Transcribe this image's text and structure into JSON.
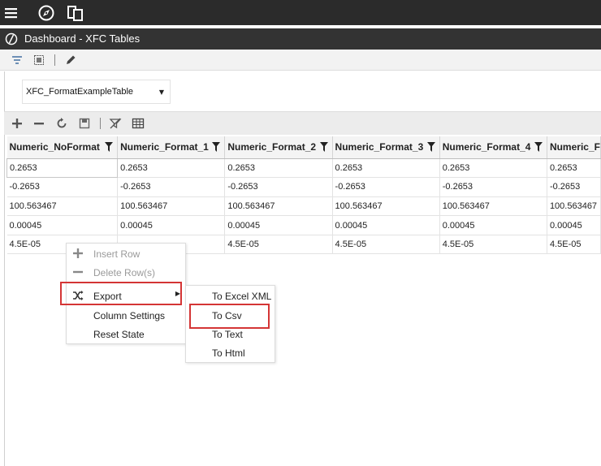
{
  "appbar": {
    "icons": [
      "hamburger-menu-icon",
      "navigation-compass-icon",
      "pages-icon"
    ]
  },
  "titlebar": {
    "title": "Dashboard - XFC Tables"
  },
  "small_toolbar": {
    "icons": [
      "filter-icon",
      "select-icon",
      "edit-pencil-icon"
    ]
  },
  "combo": {
    "value": "XFC_FormatExampleTable"
  },
  "grid_toolbar": {
    "icons": [
      "add-icon",
      "remove-icon",
      "refresh-icon",
      "save-icon",
      "clear-filter-icon",
      "export-grid-icon"
    ]
  },
  "table": {
    "columns": [
      "Numeric_NoFormat",
      "Numeric_Format_1",
      "Numeric_Format_2",
      "Numeric_Format_3",
      "Numeric_Format_4",
      "Numeric_F"
    ],
    "rows": [
      [
        "0.2653",
        "0.2653",
        "0.2653",
        "0.2653",
        "0.2653",
        "0.2653"
      ],
      [
        "-0.2653",
        "-0.2653",
        "-0.2653",
        "-0.2653",
        "-0.2653",
        "-0.2653"
      ],
      [
        "100.563467",
        "100.563467",
        "100.563467",
        "100.563467",
        "100.563467",
        "100.563467"
      ],
      [
        "0.00045",
        "0.00045",
        "0.00045",
        "0.00045",
        "0.00045",
        "0.00045"
      ],
      [
        "4.5E-05",
        "",
        "4.5E-05",
        "4.5E-05",
        "4.5E-05",
        "4.5E-05"
      ]
    ]
  },
  "context_menu": {
    "items": [
      {
        "label": "Insert Row",
        "icon": "plus-icon",
        "disabled": true
      },
      {
        "label": "Delete Row(s)",
        "icon": "minus-icon",
        "disabled": true
      },
      {
        "label": "Export",
        "icon": "export-shuffle-icon",
        "disabled": false,
        "has_submenu": true
      },
      {
        "label": "Column Settings",
        "disabled": false
      },
      {
        "label": "Reset State",
        "disabled": false
      }
    ]
  },
  "export_submenu": {
    "items": [
      {
        "label": "To Excel XML"
      },
      {
        "label": "To Csv"
      },
      {
        "label": "To Text"
      },
      {
        "label": "To Html"
      }
    ]
  },
  "colors": {
    "appbar": "#2b2b2b",
    "titlebar": "#333333",
    "highlight": "#d43535"
  }
}
